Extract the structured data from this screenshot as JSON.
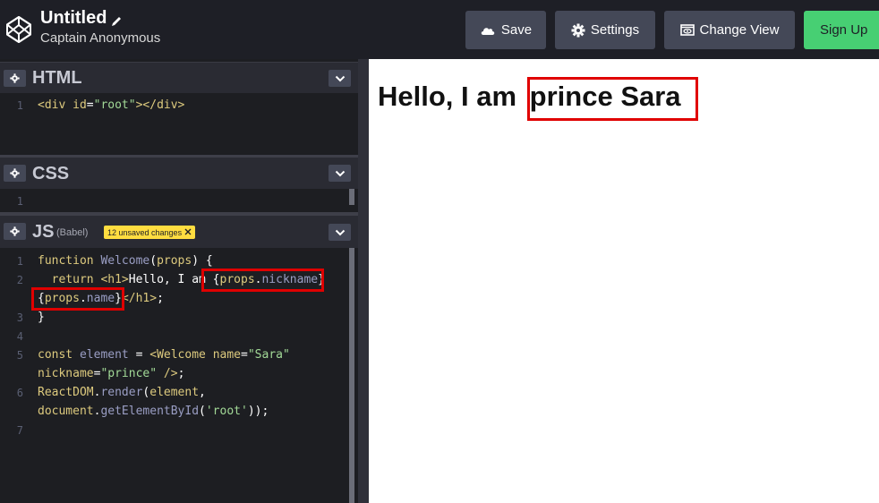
{
  "header": {
    "title": "Untitled",
    "author": "Captain Anonymous",
    "buttons": {
      "save": "Save",
      "settings": "Settings",
      "change_view": "Change View",
      "sign_up": "Sign Up"
    },
    "icons": [
      "codepen-logo-icon",
      "pencil-icon",
      "cloud-icon",
      "gear-icon",
      "eye-window-icon"
    ],
    "colors": {
      "bg": "#1e1f26",
      "button": "#444857",
      "signup": "#47cf73"
    }
  },
  "panels": {
    "html": {
      "title": "HTML",
      "lines": [
        {
          "n": "1",
          "text": "<div id=\"root\"></div>"
        }
      ]
    },
    "css": {
      "title": "CSS",
      "lines": [
        {
          "n": "1",
          "text": ""
        }
      ]
    },
    "js": {
      "title": "JS",
      "preprocessor": "(Babel)",
      "badge": "12 unsaved changes",
      "line_numbers": [
        "1",
        "2",
        "3",
        "4",
        "5",
        "6",
        "7"
      ]
    }
  },
  "preview": {
    "heading_prefix": "Hello, I am ",
    "heading_highlight": "prince Sara"
  }
}
